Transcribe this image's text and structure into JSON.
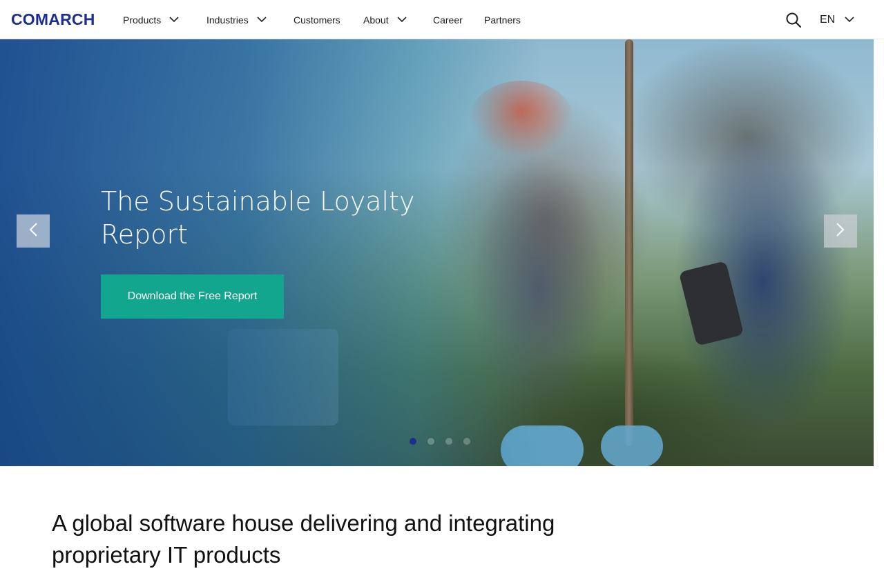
{
  "header": {
    "logo": "COMARCH",
    "nav": [
      {
        "label": "Products",
        "has_dropdown": true
      },
      {
        "label": "Industries",
        "has_dropdown": true
      },
      {
        "label": "Customers",
        "has_dropdown": false
      },
      {
        "label": "About",
        "has_dropdown": true
      },
      {
        "label": "Career",
        "has_dropdown": false
      },
      {
        "label": "Partners",
        "has_dropdown": false
      }
    ],
    "search_icon": "search-icon",
    "language": "EN"
  },
  "hero": {
    "title": "The Sustainable Loyalty Report",
    "cta_label": "Download the Free Report",
    "slides_total": 4,
    "active_slide": 1
  },
  "intro": {
    "heading": "A global software house delivering and integrating proprietary IT products"
  },
  "colors": {
    "brand": "#1c2f8f",
    "cta": "#13a68f",
    "hero_overlay": "#16488c"
  }
}
